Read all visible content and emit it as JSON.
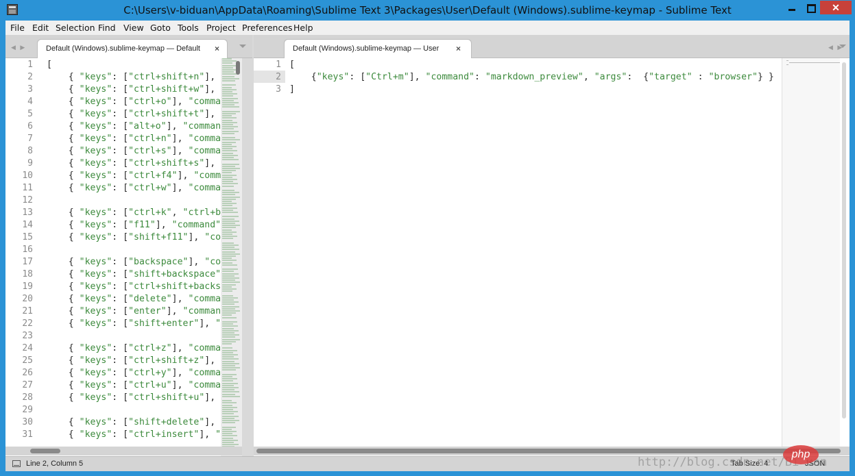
{
  "window": {
    "title": "C:\\Users\\v-biduan\\AppData\\Roaming\\Sublime Text 3\\Packages\\User\\Default (Windows).sublime-keymap - Sublime Text"
  },
  "menu": [
    "File",
    "Edit",
    "Selection",
    "Find",
    "View",
    "Goto",
    "Tools",
    "Project",
    "Preferences",
    "Help"
  ],
  "tabs": {
    "left": {
      "label": "Default (Windows).sublime-keymap — Default",
      "close": "×"
    },
    "right": {
      "label": "Default (Windows).sublime-keymap — User",
      "close": "×"
    }
  },
  "left_pane": {
    "lines": [
      {
        "n": "1",
        "text": "["
      },
      {
        "n": "2",
        "text": "    { \"keys\": [\"ctrl+shift+n\"],"
      },
      {
        "n": "3",
        "text": "    { \"keys\": [\"ctrl+shift+w\"],"
      },
      {
        "n": "4",
        "text": "    { \"keys\": [\"ctrl+o\"], \"comma"
      },
      {
        "n": "5",
        "text": "    { \"keys\": [\"ctrl+shift+t\"],"
      },
      {
        "n": "6",
        "text": "    { \"keys\": [\"alt+o\"], \"comman"
      },
      {
        "n": "7",
        "text": "    { \"keys\": [\"ctrl+n\"], \"comma"
      },
      {
        "n": "8",
        "text": "    { \"keys\": [\"ctrl+s\"], \"comma"
      },
      {
        "n": "9",
        "text": "    { \"keys\": [\"ctrl+shift+s\"],"
      },
      {
        "n": "10",
        "text": "    { \"keys\": [\"ctrl+f4\"], \"comm"
      },
      {
        "n": "11",
        "text": "    { \"keys\": [\"ctrl+w\"], \"comma"
      },
      {
        "n": "12",
        "text": ""
      },
      {
        "n": "13",
        "text": "    { \"keys\": [\"ctrl+k\", \"ctrl+b"
      },
      {
        "n": "14",
        "text": "    { \"keys\": [\"f11\"], \"command\""
      },
      {
        "n": "15",
        "text": "    { \"keys\": [\"shift+f11\"], \"co"
      },
      {
        "n": "16",
        "text": ""
      },
      {
        "n": "17",
        "text": "    { \"keys\": [\"backspace\"], \"co"
      },
      {
        "n": "18",
        "text": "    { \"keys\": [\"shift+backspace\""
      },
      {
        "n": "19",
        "text": "    { \"keys\": [\"ctrl+shift+backs"
      },
      {
        "n": "20",
        "text": "    { \"keys\": [\"delete\"], \"comma"
      },
      {
        "n": "21",
        "text": "    { \"keys\": [\"enter\"], \"command"
      },
      {
        "n": "22",
        "text": "    { \"keys\": [\"shift+enter\"], \""
      },
      {
        "n": "23",
        "text": ""
      },
      {
        "n": "24",
        "text": "    { \"keys\": [\"ctrl+z\"], \"comma"
      },
      {
        "n": "25",
        "text": "    { \"keys\": [\"ctrl+shift+z\"],"
      },
      {
        "n": "26",
        "text": "    { \"keys\": [\"ctrl+y\"], \"comma"
      },
      {
        "n": "27",
        "text": "    { \"keys\": [\"ctrl+u\"], \"comma"
      },
      {
        "n": "28",
        "text": "    { \"keys\": [\"ctrl+shift+u\"],"
      },
      {
        "n": "29",
        "text": ""
      },
      {
        "n": "30",
        "text": "    { \"keys\": [\"shift+delete\"],"
      },
      {
        "n": "31",
        "text": "    { \"keys\": [\"ctrl+insert\"], \""
      }
    ]
  },
  "right_pane": {
    "lines": [
      {
        "n": "1",
        "text": "["
      },
      {
        "n": "2",
        "text": "    {\"keys\": [\"Ctrl+m\"], \"command\": \"markdown_preview\", \"args\":  {\"target\" : \"browser\"} }"
      },
      {
        "n": "3",
        "text": "]"
      }
    ],
    "current_line": "2"
  },
  "status": {
    "position": "Line 2, Column 5",
    "tab_size": "Tab Size: 4",
    "syntax": "JSON"
  },
  "watermark": {
    "url": "http://blog.csdn.net/Bi  uan",
    "logo": "php"
  }
}
